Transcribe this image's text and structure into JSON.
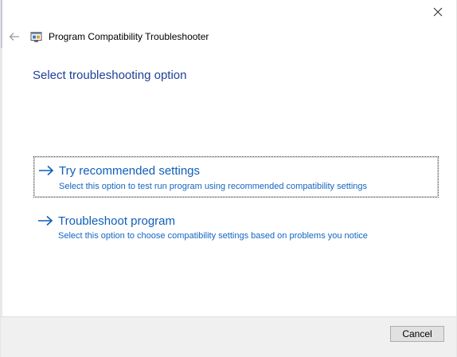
{
  "window": {
    "title": "Program Compatibility Troubleshooter",
    "icons": {
      "close": "close-icon",
      "back": "back-arrow-icon",
      "app": "troubleshooter-icon"
    }
  },
  "main": {
    "heading": "Select troubleshooting option",
    "options": [
      {
        "title": "Try recommended settings",
        "description": "Select this option to test run program using recommended compatibility settings",
        "icon": "arrow-right-icon",
        "focused": true
      },
      {
        "title": "Troubleshoot program",
        "description": "Select this option to choose compatibility settings based on problems you notice",
        "icon": "arrow-right-icon",
        "focused": false
      }
    ]
  },
  "footer": {
    "cancel_label": "Cancel"
  },
  "colors": {
    "heading": "#1f3f96",
    "link": "#0f5fb8",
    "description": "#1565c0",
    "footer_bg": "#f0f0f0"
  }
}
